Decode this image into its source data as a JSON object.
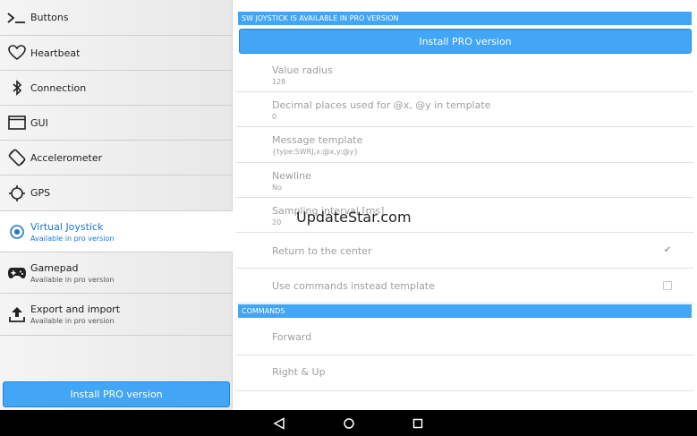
{
  "sidebar": {
    "items": [
      {
        "label": "Buttons",
        "sub": "",
        "icon": "terminal-icon"
      },
      {
        "label": "Heartbeat",
        "sub": "",
        "icon": "heart-icon"
      },
      {
        "label": "Connection",
        "sub": "",
        "icon": "bluetooth-icon"
      },
      {
        "label": "GUI",
        "sub": "",
        "icon": "window-icon"
      },
      {
        "label": "Accelerometer",
        "sub": "",
        "icon": "screen-rotation-icon"
      },
      {
        "label": "GPS",
        "sub": "",
        "icon": "gps-crosshair-icon"
      },
      {
        "label": "Virtual Joystick",
        "sub": "Available in pro version",
        "icon": "radio-dot-icon"
      },
      {
        "label": "Gamepad",
        "sub": "Available in pro version",
        "icon": "gamepad-icon"
      },
      {
        "label": "Export and import",
        "sub": "Available in pro version",
        "icon": "upload-icon"
      }
    ],
    "install_button": "Install PRO version"
  },
  "main": {
    "header": "SW JOYSTICK IS AVAILABLE IN PRO VERSION",
    "install_button": "Install PRO version",
    "prefs": [
      {
        "title": "Value radius",
        "value": "128"
      },
      {
        "title": "Decimal places used for @x, @y in template",
        "value": "0"
      },
      {
        "title": "Message template",
        "value": "{type:SWRJ,x:@x,y:@y}"
      },
      {
        "title": "Newline",
        "value": "No"
      },
      {
        "title": "Sampling interval [ms]",
        "value": "20"
      },
      {
        "title": "Return to the center",
        "value": ""
      },
      {
        "title": "Use commands instead template",
        "value": ""
      }
    ],
    "commands_header": "COMMANDS",
    "commands": [
      {
        "title": "Forward"
      },
      {
        "title": "Right & Up"
      }
    ]
  },
  "watermark": "UpdateStar.com",
  "colors": {
    "accent": "#42a5f5",
    "active": "#1976d2"
  }
}
